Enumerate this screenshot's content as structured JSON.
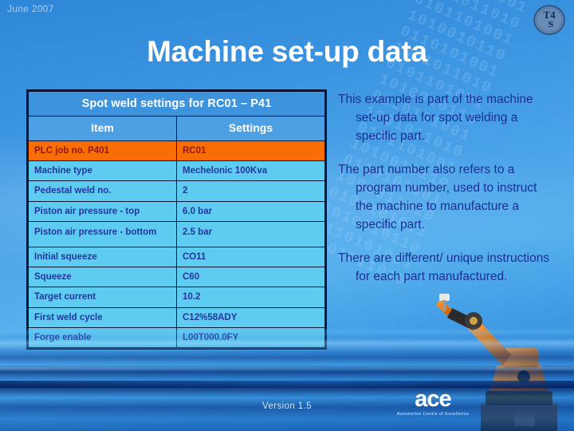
{
  "header": {
    "date": "June 2007",
    "badge_logo_text": "T4S"
  },
  "title": "Machine set-up data",
  "table": {
    "caption": "Spot weld settings for RC01 – P41",
    "columns": [
      "Item",
      "Settings"
    ],
    "highlight_color": "#f96d06",
    "rows": [
      {
        "item": "PLC job no. P401",
        "setting": "RC01",
        "highlight": true
      },
      {
        "item": "Machine type",
        "setting": "Mechelonic 100Kva",
        "highlight": false
      },
      {
        "item": "Pedestal weld no.",
        "setting": "2",
        "highlight": false
      },
      {
        "item": "Piston air pressure - top",
        "setting": "6.0 bar",
        "highlight": false
      },
      {
        "item": "Piston air pressure - bottom",
        "setting": "2.5 bar",
        "highlight": false
      },
      {
        "item": "Initial squeeze",
        "setting": "CO11",
        "highlight": false
      },
      {
        "item": "Squeeze",
        "setting": "C60",
        "highlight": false
      },
      {
        "item": "Target current",
        "setting": "10.2",
        "highlight": false
      },
      {
        "item": "First weld cycle",
        "setting": "C12%58ADY",
        "highlight": false
      },
      {
        "item": "Forge enable",
        "setting": "L00T000.0FY",
        "highlight": false
      }
    ]
  },
  "notes": [
    "This example is part of the machine set-up data for spot welding a specific part.",
    "The part number also refers to a program number, used to instruct the machine to manufacture a specific part.",
    "There are different/ unique instructions for each part manufactured."
  ],
  "footer": {
    "version": "Version 1.5",
    "logo_mark": "ace",
    "logo_subtitle": "Automotive Centre of Excellence"
  },
  "decor": {
    "binary_rows": [
      "0101101001",
      "1010010110",
      "0110101001",
      "1001011010",
      "0101101001",
      "1010010110",
      "0110101001",
      "1001011010",
      "0101101001",
      "1010010110",
      "0110101001",
      "1001011010",
      "0101101001",
      "1010010110",
      "0110101001",
      "1001011010",
      "0101101001",
      "1010010110",
      "0110101001",
      "1001011010"
    ]
  }
}
